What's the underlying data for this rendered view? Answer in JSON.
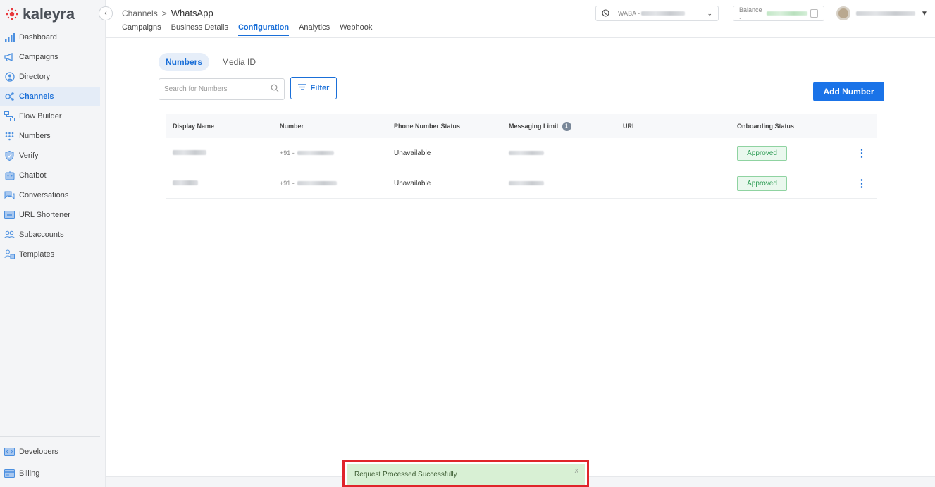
{
  "brand": {
    "name": "kaleyra"
  },
  "sidebar": {
    "items": [
      {
        "label": "Dashboard",
        "icon": "bar-chart-icon",
        "active": false
      },
      {
        "label": "Campaigns",
        "icon": "megaphone-icon",
        "active": false
      },
      {
        "label": "Directory",
        "icon": "contact-icon",
        "active": false
      },
      {
        "label": "Channels",
        "icon": "channels-icon",
        "active": true
      },
      {
        "label": "Flow Builder",
        "icon": "flow-icon",
        "active": false
      },
      {
        "label": "Numbers",
        "icon": "dialpad-icon",
        "active": false
      },
      {
        "label": "Verify",
        "icon": "shield-icon",
        "active": false
      },
      {
        "label": "Chatbot",
        "icon": "chatbot-icon",
        "active": false
      },
      {
        "label": "Conversations",
        "icon": "chat-bubbles-icon",
        "active": false
      },
      {
        "label": "URL Shortener",
        "icon": "link-icon",
        "active": false
      },
      {
        "label": "Subaccounts",
        "icon": "users-icon",
        "active": false
      },
      {
        "label": "Templates",
        "icon": "templates-icon",
        "active": false
      }
    ],
    "bottom_items": [
      {
        "label": "Developers",
        "icon": "code-icon"
      },
      {
        "label": "Billing",
        "icon": "billing-icon"
      }
    ]
  },
  "header": {
    "breadcrumb_parent": "Channels",
    "breadcrumb_separator": ">",
    "breadcrumb_current": "WhatsApp",
    "subtabs": [
      "Campaigns",
      "Business Details",
      "Configuration",
      "Analytics",
      "Webhook"
    ],
    "active_subtab": "Configuration",
    "waba_label": "WABA -",
    "balance_label": "Balance :"
  },
  "main": {
    "pills": [
      "Numbers",
      "Media ID"
    ],
    "active_pill": "Numbers",
    "search_placeholder": "Search for Numbers",
    "filter_label": "Filter",
    "add_button_label": "Add Number"
  },
  "table": {
    "columns": [
      "Display Name",
      "Number",
      "Phone Number Status",
      "Messaging Limit",
      "URL",
      "Onboarding Status"
    ],
    "rows": [
      {
        "number_prefix": "+91 -",
        "phone_status": "Unavailable",
        "url": "",
        "onboarding": "Approved"
      },
      {
        "number_prefix": "+91 -",
        "phone_status": "Unavailable",
        "url": "",
        "onboarding": "Approved"
      }
    ]
  },
  "toast": {
    "message": "Request Processed Successfully",
    "close_label": "x"
  },
  "colors": {
    "accent": "#1a73e8",
    "success": "#2f9d55",
    "toast_border": "#e0242a"
  }
}
